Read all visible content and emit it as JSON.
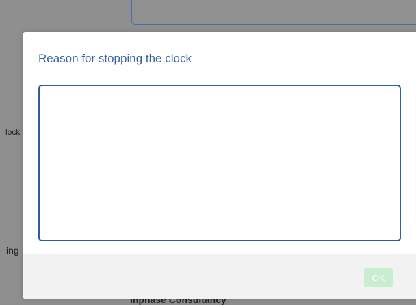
{
  "background": {
    "left_label_1": "lock",
    "left_label_2": "ing",
    "bottom_label": "Inphase Consultancy"
  },
  "modal": {
    "title": "Reason for stopping the clock",
    "reason_value": "",
    "ok_label": "OK",
    "ok_enabled": false
  },
  "colors": {
    "title": "#3a63a3",
    "textarea_border": "#2e5e9e",
    "ok_disabled_bg": "#c9edcf",
    "footer_bg": "#f2f2f2",
    "backdrop": "#8f8f8f"
  }
}
